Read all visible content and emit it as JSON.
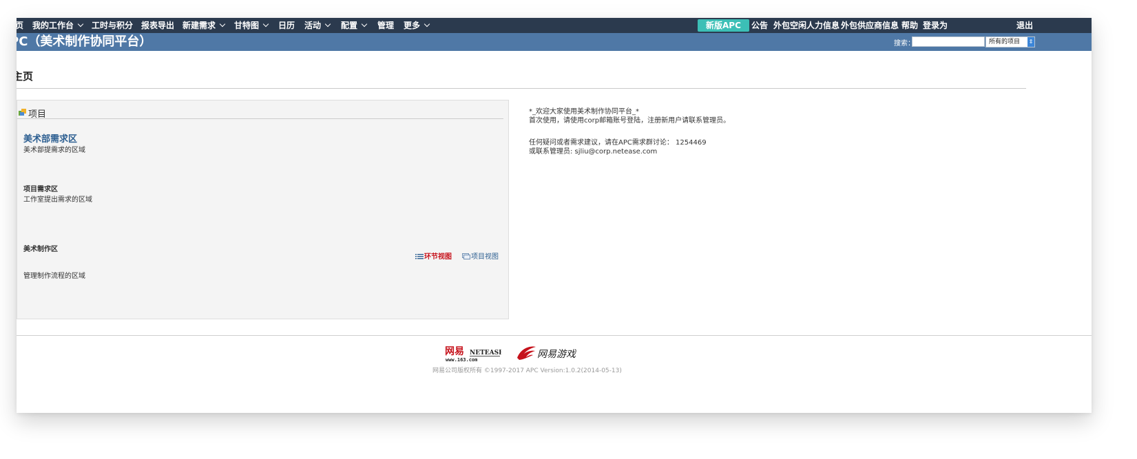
{
  "topnav": {
    "items": [
      {
        "label": "页",
        "dropdown": false
      },
      {
        "label": "我的工作台",
        "dropdown": true
      },
      {
        "label": "工时与积分",
        "dropdown": false
      },
      {
        "label": "报表导出",
        "dropdown": false
      },
      {
        "label": "新建需求",
        "dropdown": true
      },
      {
        "label": "甘特图",
        "dropdown": true
      },
      {
        "label": "日历",
        "dropdown": false
      },
      {
        "label": "活动",
        "dropdown": true
      },
      {
        "label": "配置",
        "dropdown": true
      },
      {
        "label": "管理",
        "dropdown": false
      },
      {
        "label": "更多",
        "dropdown": true
      }
    ],
    "new_apc_label": "新版APC",
    "right_items": [
      "公告",
      "外包空闲人力信息",
      "外包供应商信息",
      "帮助",
      "登录为"
    ],
    "logout_label": "退出",
    "colors": {
      "bar": "#2b3a4e",
      "new_apc": "#3cbfb6"
    }
  },
  "header": {
    "title": "PC（美术制作协同平台）",
    "search_label": "搜索：",
    "search_value": "",
    "scope_selected": "所有的项目",
    "color": "#4f78a6"
  },
  "page": {
    "heading": "主页"
  },
  "projects_panel": {
    "title": "项目",
    "zones": [
      {
        "title": "美术部需求区",
        "desc": "美术部提需求的区域"
      },
      {
        "title": "项目需求区",
        "desc": "工作室提出需求的区域"
      },
      {
        "title": "美术制作区",
        "desc": "管理制作流程的区域"
      }
    ],
    "link_stage_view": "环节视图",
    "link_project_view": "项目视图"
  },
  "welcome": {
    "line1": "*_欢迎大家使用美术制作协同平台_*",
    "line2": "首次使用，请使用corp邮箱账号登陆，注册新用户请联系管理员。",
    "line3": "任何疑问或者需求建议，请在APC需求群讨论： 1254469",
    "line4": "或联系管理员: sjliu@corp.netease.com"
  },
  "footer": {
    "logo_netease_cn": "网易",
    "logo_netease_en": "NETEASE",
    "logo_netease_url": "www.163.com",
    "logo_games": "网易游戏",
    "copyright": "网易公司版权所有 ©1997-2017 APC Version:1.0.2(2014-05-13)"
  }
}
